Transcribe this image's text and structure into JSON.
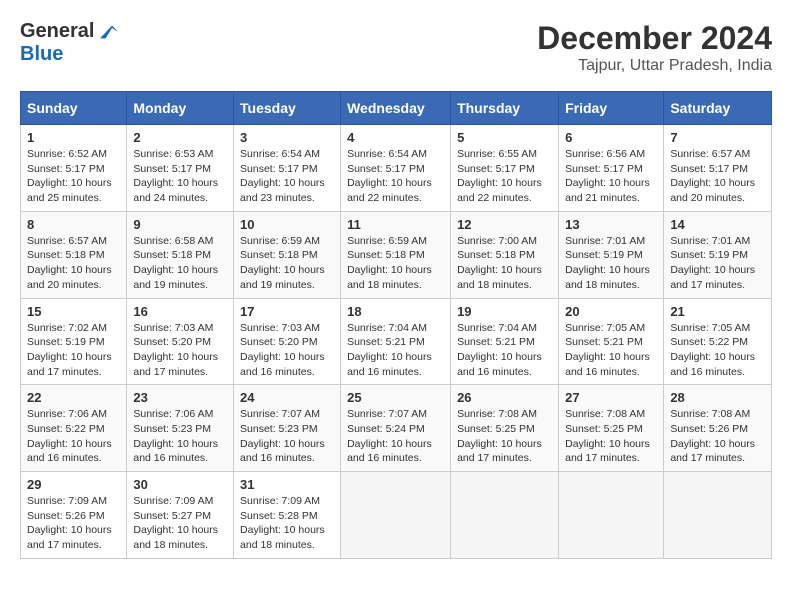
{
  "logo": {
    "general": "General",
    "blue": "Blue"
  },
  "title": {
    "month_year": "December 2024",
    "location": "Tajpur, Uttar Pradesh, India"
  },
  "days_of_week": [
    "Sunday",
    "Monday",
    "Tuesday",
    "Wednesday",
    "Thursday",
    "Friday",
    "Saturday"
  ],
  "weeks": [
    [
      {
        "day": "1",
        "sunrise": "6:52 AM",
        "sunset": "5:17 PM",
        "daylight": "10 hours and 25 minutes."
      },
      {
        "day": "2",
        "sunrise": "6:53 AM",
        "sunset": "5:17 PM",
        "daylight": "10 hours and 24 minutes."
      },
      {
        "day": "3",
        "sunrise": "6:54 AM",
        "sunset": "5:17 PM",
        "daylight": "10 hours and 23 minutes."
      },
      {
        "day": "4",
        "sunrise": "6:54 AM",
        "sunset": "5:17 PM",
        "daylight": "10 hours and 22 minutes."
      },
      {
        "day": "5",
        "sunrise": "6:55 AM",
        "sunset": "5:17 PM",
        "daylight": "10 hours and 22 minutes."
      },
      {
        "day": "6",
        "sunrise": "6:56 AM",
        "sunset": "5:17 PM",
        "daylight": "10 hours and 21 minutes."
      },
      {
        "day": "7",
        "sunrise": "6:57 AM",
        "sunset": "5:17 PM",
        "daylight": "10 hours and 20 minutes."
      }
    ],
    [
      {
        "day": "8",
        "sunrise": "6:57 AM",
        "sunset": "5:18 PM",
        "daylight": "10 hours and 20 minutes."
      },
      {
        "day": "9",
        "sunrise": "6:58 AM",
        "sunset": "5:18 PM",
        "daylight": "10 hours and 19 minutes."
      },
      {
        "day": "10",
        "sunrise": "6:59 AM",
        "sunset": "5:18 PM",
        "daylight": "10 hours and 19 minutes."
      },
      {
        "day": "11",
        "sunrise": "6:59 AM",
        "sunset": "5:18 PM",
        "daylight": "10 hours and 18 minutes."
      },
      {
        "day": "12",
        "sunrise": "7:00 AM",
        "sunset": "5:18 PM",
        "daylight": "10 hours and 18 minutes."
      },
      {
        "day": "13",
        "sunrise": "7:01 AM",
        "sunset": "5:19 PM",
        "daylight": "10 hours and 18 minutes."
      },
      {
        "day": "14",
        "sunrise": "7:01 AM",
        "sunset": "5:19 PM",
        "daylight": "10 hours and 17 minutes."
      }
    ],
    [
      {
        "day": "15",
        "sunrise": "7:02 AM",
        "sunset": "5:19 PM",
        "daylight": "10 hours and 17 minutes."
      },
      {
        "day": "16",
        "sunrise": "7:03 AM",
        "sunset": "5:20 PM",
        "daylight": "10 hours and 17 minutes."
      },
      {
        "day": "17",
        "sunrise": "7:03 AM",
        "sunset": "5:20 PM",
        "daylight": "10 hours and 16 minutes."
      },
      {
        "day": "18",
        "sunrise": "7:04 AM",
        "sunset": "5:21 PM",
        "daylight": "10 hours and 16 minutes."
      },
      {
        "day": "19",
        "sunrise": "7:04 AM",
        "sunset": "5:21 PM",
        "daylight": "10 hours and 16 minutes."
      },
      {
        "day": "20",
        "sunrise": "7:05 AM",
        "sunset": "5:21 PM",
        "daylight": "10 hours and 16 minutes."
      },
      {
        "day": "21",
        "sunrise": "7:05 AM",
        "sunset": "5:22 PM",
        "daylight": "10 hours and 16 minutes."
      }
    ],
    [
      {
        "day": "22",
        "sunrise": "7:06 AM",
        "sunset": "5:22 PM",
        "daylight": "10 hours and 16 minutes."
      },
      {
        "day": "23",
        "sunrise": "7:06 AM",
        "sunset": "5:23 PM",
        "daylight": "10 hours and 16 minutes."
      },
      {
        "day": "24",
        "sunrise": "7:07 AM",
        "sunset": "5:23 PM",
        "daylight": "10 hours and 16 minutes."
      },
      {
        "day": "25",
        "sunrise": "7:07 AM",
        "sunset": "5:24 PM",
        "daylight": "10 hours and 16 minutes."
      },
      {
        "day": "26",
        "sunrise": "7:08 AM",
        "sunset": "5:25 PM",
        "daylight": "10 hours and 17 minutes."
      },
      {
        "day": "27",
        "sunrise": "7:08 AM",
        "sunset": "5:25 PM",
        "daylight": "10 hours and 17 minutes."
      },
      {
        "day": "28",
        "sunrise": "7:08 AM",
        "sunset": "5:26 PM",
        "daylight": "10 hours and 17 minutes."
      }
    ],
    [
      {
        "day": "29",
        "sunrise": "7:09 AM",
        "sunset": "5:26 PM",
        "daylight": "10 hours and 17 minutes."
      },
      {
        "day": "30",
        "sunrise": "7:09 AM",
        "sunset": "5:27 PM",
        "daylight": "10 hours and 18 minutes."
      },
      {
        "day": "31",
        "sunrise": "7:09 AM",
        "sunset": "5:28 PM",
        "daylight": "10 hours and 18 minutes."
      },
      null,
      null,
      null,
      null
    ]
  ],
  "labels": {
    "sunrise": "Sunrise:",
    "sunset": "Sunset:",
    "daylight": "Daylight:"
  }
}
